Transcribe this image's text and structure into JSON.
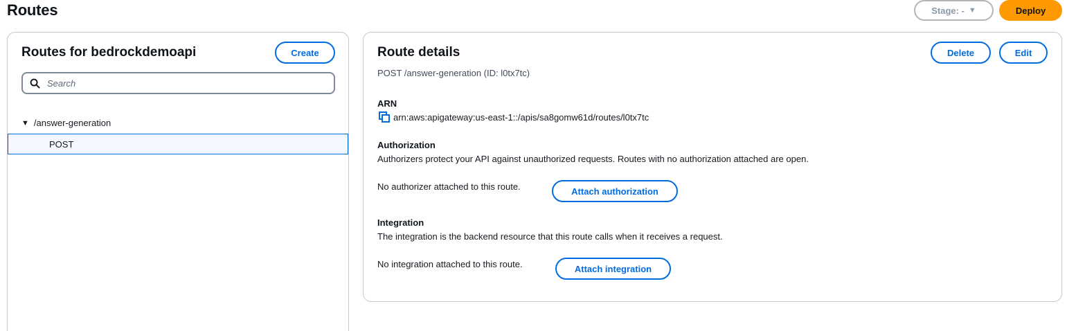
{
  "page": {
    "title": "Routes"
  },
  "header": {
    "stage_label": "Stage: -",
    "deploy_label": "Deploy"
  },
  "routes_panel": {
    "title": "Routes for bedrockdemoapi",
    "create_label": "Create",
    "search": {
      "placeholder": "Search",
      "value": ""
    },
    "tree": [
      {
        "path": "/answer-generation",
        "methods": [
          "POST"
        ]
      }
    ]
  },
  "details_panel": {
    "title": "Route details",
    "delete_label": "Delete",
    "edit_label": "Edit",
    "subtitle": "POST /answer-generation (ID: l0tx7tc)",
    "arn": {
      "label": "ARN",
      "value": "arn:aws:apigateway:us-east-1::/apis/sa8gomw61d/routes/l0tx7tc"
    },
    "authorization": {
      "label": "Authorization",
      "description": "Authorizers protect your API against unauthorized requests. Routes with no authorization attached are open.",
      "status": "No authorizer attached to this route.",
      "button_label": "Attach authorization"
    },
    "integration": {
      "label": "Integration",
      "description": "The integration is the backend resource that this route calls when it receives a request.",
      "status": "No integration attached to this route.",
      "button_label": "Attach integration"
    }
  },
  "colors": {
    "accent": "#006ce0",
    "deploy": "#ff9900",
    "selected_bg": "#f2f8fd",
    "border": "#c6c6cd"
  },
  "icons": {
    "search": "search-icon",
    "copy": "copy-icon",
    "caret": "caret-down-icon"
  }
}
